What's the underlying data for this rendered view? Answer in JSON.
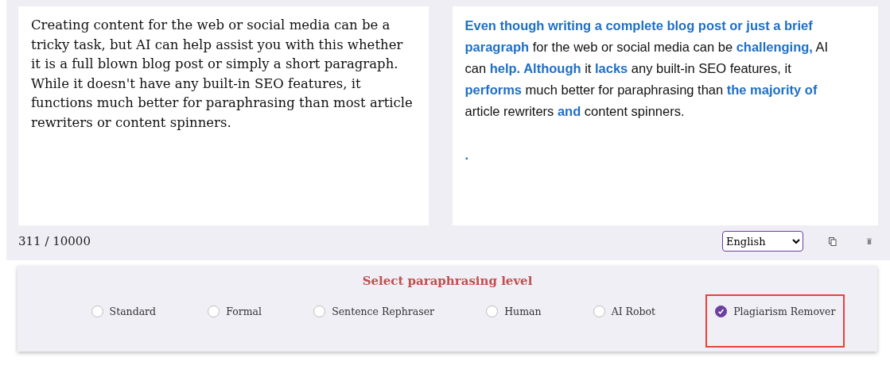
{
  "input": {
    "text": "Creating content for the web or social media can be a tricky task, but AI can help assist you with this whether it is a full blown blog post or simply a short paragraph. While it doesn't have any built-in SEO features, it functions much better for paraphrasing than most article rewriters or content spinners."
  },
  "output": {
    "segments": [
      {
        "text": "Even though writing a complete blog post or just a brief paragraph",
        "changed": true
      },
      {
        "text": " for the web or social media can be ",
        "changed": false
      },
      {
        "text": "challenging,",
        "changed": true
      },
      {
        "text": " AI can ",
        "changed": false
      },
      {
        "text": "help. Although",
        "changed": true
      },
      {
        "text": " it ",
        "changed": false
      },
      {
        "text": "lacks",
        "changed": true
      },
      {
        "text": " any built-in SEO features, it ",
        "changed": false
      },
      {
        "text": "performs",
        "changed": true
      },
      {
        "text": " much better for paraphrasing than ",
        "changed": false
      },
      {
        "text": "the majority of",
        "changed": true
      },
      {
        "text": " article rewriters ",
        "changed": false
      },
      {
        "text": "and",
        "changed": true
      },
      {
        "text": " content spinners.",
        "changed": false
      }
    ],
    "trailing": "."
  },
  "counter": "311 / 10000",
  "language": {
    "value": "English"
  },
  "levels": {
    "title": "Select paraphrasing level",
    "options": [
      {
        "label": "Standard",
        "selected": false,
        "highlighted": false
      },
      {
        "label": "Formal",
        "selected": false,
        "highlighted": false
      },
      {
        "label": "Sentence Rephraser",
        "selected": false,
        "highlighted": false
      },
      {
        "label": "Human",
        "selected": false,
        "highlighted": false
      },
      {
        "label": "AI Robot",
        "selected": false,
        "highlighted": false
      },
      {
        "label": "Plagiarism Remover",
        "selected": true,
        "highlighted": true
      }
    ]
  }
}
